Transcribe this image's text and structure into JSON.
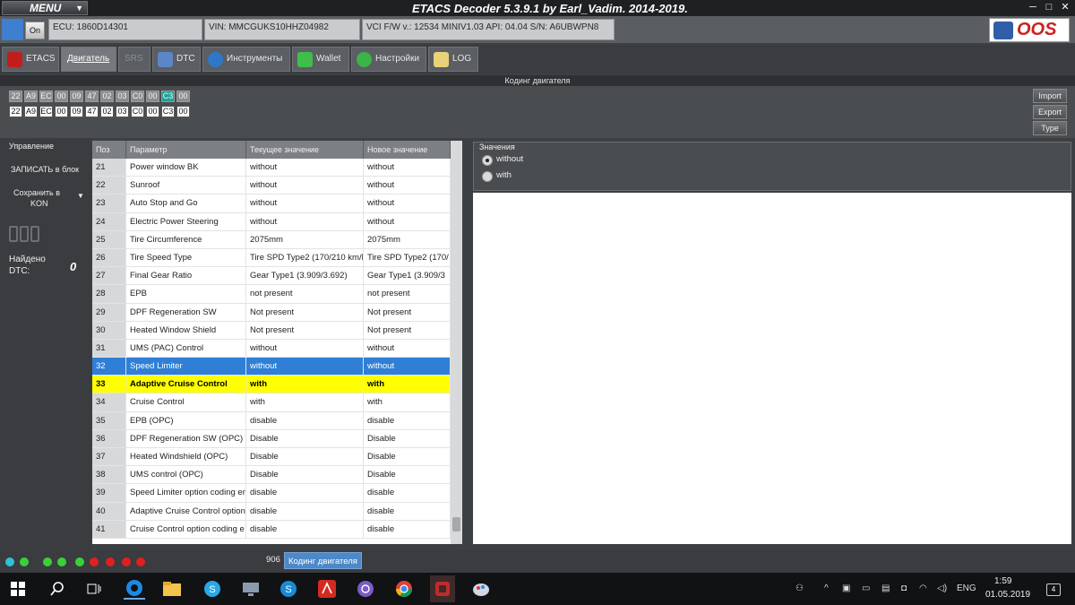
{
  "window": {
    "menu_label": "MENU",
    "title": "ETACS Decoder 5.3.9.1 by Earl_Vadim. 2014-2019."
  },
  "infobar": {
    "on_label": "On",
    "ecu": "ECU: 1860D14301",
    "vin": "VIN: MMCGUKS10HHZ04982",
    "vci": "VCI F/W v.: 12534 MINIV1.03 API: 04.04 S/N: A6UBWPN8",
    "logo_text": "OOS"
  },
  "tabs": [
    {
      "label": "ETACS"
    },
    {
      "label": "Двигатель"
    },
    {
      "label": "SRS"
    },
    {
      "label": "DTC"
    },
    {
      "label": "Инструменты"
    },
    {
      "label": "Wallet"
    },
    {
      "label": "Настройки"
    },
    {
      "label": "LOG"
    }
  ],
  "coding_header": "Кодинг двигателя",
  "hex": {
    "row1": [
      "22",
      "A9",
      "EC",
      "00",
      "09",
      "47",
      "02",
      "03",
      "C0",
      "00",
      "C3",
      "00"
    ],
    "row2": [
      "22",
      "A9",
      "EC",
      "00",
      "09",
      "47",
      "02",
      "03",
      "C0",
      "00",
      "C3",
      "00"
    ]
  },
  "side_buttons": {
    "import": "Import",
    "export": "Export",
    "type": "Type"
  },
  "left_panel": {
    "control": "Управление",
    "write": "ЗАПИСАТЬ в блок",
    "save_line1": "Сохранить в",
    "save_line2": "KON",
    "found": "Найдено",
    "dtc": "DTC:",
    "dtc_count": "0"
  },
  "table": {
    "headers": [
      "Поз",
      "Параметр",
      "Текущее значение",
      "Новое значение"
    ],
    "rows": [
      {
        "pos": "21",
        "param": "Power window BK",
        "current": "without",
        "new": "without"
      },
      {
        "pos": "22",
        "param": "Sunroof",
        "current": "without",
        "new": "without"
      },
      {
        "pos": "23",
        "param": "Auto Stop and Go",
        "current": "without",
        "new": "without"
      },
      {
        "pos": "24",
        "param": "Electric Power Steering",
        "current": "without",
        "new": "without"
      },
      {
        "pos": "25",
        "param": "Tire Circumference",
        "current": "2075mm",
        "new": "2075mm"
      },
      {
        "pos": "26",
        "param": "Tire Speed Type",
        "current": "Tire SPD Type2 (170/210 km/h",
        "new": "Tire SPD Type2 (170/"
      },
      {
        "pos": "27",
        "param": "Final Gear Ratio",
        "current": "Gear Type1 (3.909/3.692)",
        "new": "Gear Type1 (3.909/3"
      },
      {
        "pos": "28",
        "param": "EPB",
        "current": "not present",
        "new": "not present"
      },
      {
        "pos": "29",
        "param": "DPF Regeneration SW",
        "current": "Not present",
        "new": "Not present"
      },
      {
        "pos": "30",
        "param": "Heated Window Shield",
        "current": "Not present",
        "new": "Not present"
      },
      {
        "pos": "31",
        "param": "UMS (PAC) Control",
        "current": "without",
        "new": "without"
      },
      {
        "pos": "32",
        "param": "Speed Limiter",
        "current": "without",
        "new": "without"
      },
      {
        "pos": "33",
        "param": "Adaptive Cruise Control",
        "current": "with",
        "new": "with"
      },
      {
        "pos": "34",
        "param": "Cruise Control",
        "current": "with",
        "new": "with"
      },
      {
        "pos": "35",
        "param": "EPB (OPC)",
        "current": "disable",
        "new": "disable"
      },
      {
        "pos": "36",
        "param": "DPF Regeneration SW (OPC)",
        "current": "Disable",
        "new": "Disable"
      },
      {
        "pos": "37",
        "param": "Heated Windshield (OPC)",
        "current": "Disable",
        "new": "Disable"
      },
      {
        "pos": "38",
        "param": "UMS control (OPC)",
        "current": "Disable",
        "new": "Disable"
      },
      {
        "pos": "39",
        "param": "Speed Limiter option coding en",
        "current": "disable",
        "new": "disable"
      },
      {
        "pos": "40",
        "param": "Adaptive Cruise Control option",
        "current": "disable",
        "new": "disable"
      },
      {
        "pos": "41",
        "param": "Cruise Control option coding e",
        "current": "disable",
        "new": "disable"
      }
    ]
  },
  "values_panel": {
    "title": "Значения",
    "options": [
      {
        "label": "without",
        "selected": true
      },
      {
        "label": "with",
        "selected": false
      }
    ]
  },
  "statusbar": {
    "number": "906",
    "label": "Кодинг двигателя",
    "leds": [
      "#2fc1d6",
      "#39d13a",
      "#39d13a",
      "#39d13a",
      "#39d13a",
      "#e02020",
      "#e02020",
      "#e02020",
      "#e02020"
    ]
  },
  "taskbar": {
    "lang": "ENG",
    "time": "1:59",
    "date": "01.05.2019",
    "notifications": "4"
  }
}
